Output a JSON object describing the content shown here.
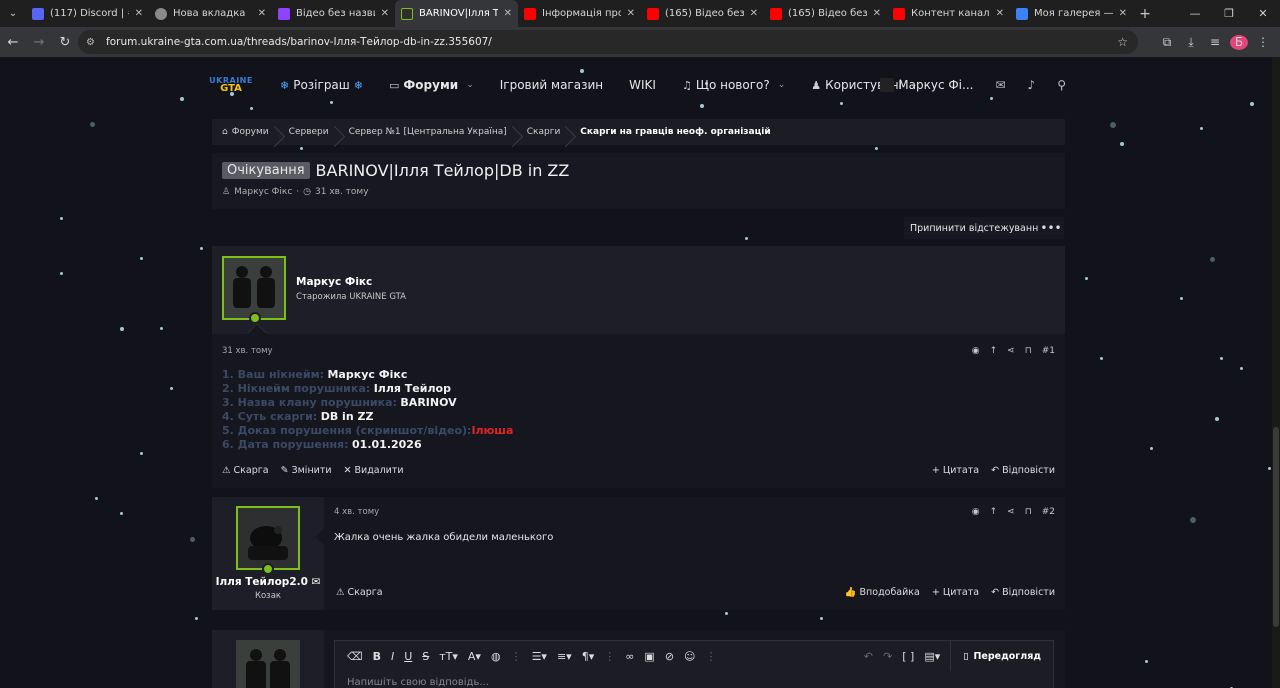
{
  "browser": {
    "tabs": [
      {
        "title": "(117) Discord | #   ",
        "color": "#5865f2",
        "active": false
      },
      {
        "title": "Нова вкладка",
        "color": "#8a8a8a",
        "active": false
      },
      {
        "title": "Відео без назви",
        "color": "#8e44ff",
        "active": false
      },
      {
        "title": "BARINOV|Ілля Тейлор",
        "color": "#2e2e2e",
        "active": true
      },
      {
        "title": "Інформація про відео",
        "color": "#ff0000",
        "active": false
      },
      {
        "title": "(165) Відео без назви",
        "color": "#ff0000",
        "active": false
      },
      {
        "title": "(165) Відео без назви",
        "color": "#ff0000",
        "active": false
      },
      {
        "title": "Контент каналу - YouTube",
        "color": "#ff0000",
        "active": false
      },
      {
        "title": "Моя галерея — Posts",
        "color": "#3b82f6",
        "active": false
      }
    ],
    "url": "forum.ukraine-gta.com.ua/threads/barinov-Ілля-Тейлор-db-in-zz.355607/",
    "profile_initial": "Б"
  },
  "nav": {
    "logo_top": "UKRAINE",
    "logo_bottom": "GTA",
    "items": [
      {
        "label": "Розіграш",
        "icon": "❄",
        "suffix": "❄"
      },
      {
        "label": "Форуми",
        "icon": "▭",
        "bold": true,
        "chevron": "⌄"
      },
      {
        "label": "Ігровий магазин"
      },
      {
        "label": "WIKI"
      },
      {
        "label": "Що нового?",
        "icon": "🔔",
        "chevron": "⌄"
      },
      {
        "label": "Користувачі",
        "icon": "👥",
        "chevron": "⌄"
      }
    ],
    "user": "Маркус Фі..."
  },
  "breadcrumbs": [
    "Форуми",
    "Сервери",
    "Сервер №1 [Центральна Україна]",
    "Скарги",
    "Скарги на гравців неоф. організацій"
  ],
  "thread": {
    "prefix": "Очікування",
    "title": "BARINOV|Ілля Тейлор|DB in ZZ",
    "author": "Маркус Фікс",
    "time": "31 хв. тому"
  },
  "controls": {
    "unwatch": "Припинити відстежування",
    "more": "•••"
  },
  "post1": {
    "author": "Маркус Фікс",
    "rank": "Старожила UKRAINE GTA",
    "date": "31 хв. тому",
    "number": "#1",
    "lines": [
      {
        "q": "1. Ваш нікнейм:",
        "a": "Маркус Фікс"
      },
      {
        "q": "2. Нікнейм порушника:",
        "a": "Ілля Тейлор"
      },
      {
        "q": "3. Назва клану порушника:",
        "a": "BARINOV"
      },
      {
        "q": "4. Суть скарги:",
        "a": "DB in ZZ"
      },
      {
        "q": "5. Доказ порушення (скриншот/відео):",
        "a": "Ілюша",
        "red": true
      },
      {
        "q": "6. Дата порушення:",
        "a": "01.01.2026"
      }
    ],
    "actions": {
      "report": "Скарга",
      "edit": "Змінити",
      "delete": "Видалити",
      "quote": "Цитата",
      "reply": "Відповісти"
    }
  },
  "post2": {
    "author": "Ілля Тейлор2.0",
    "rank": "Козак",
    "date": "4 хв. тому",
    "number": "#2",
    "message": "Жалка очень жалка обидели маленького",
    "actions": {
      "report": "Скарга",
      "like": "Вподобайка",
      "quote": "Цитата",
      "reply": "Відповісти"
    }
  },
  "editor": {
    "preview": "Передогляд",
    "placeholder": "Напишіть свою відповідь..."
  },
  "colors": {
    "accent_green": "#7ec01a",
    "red_text": "#e02424",
    "question_text": "#3a4a66"
  }
}
